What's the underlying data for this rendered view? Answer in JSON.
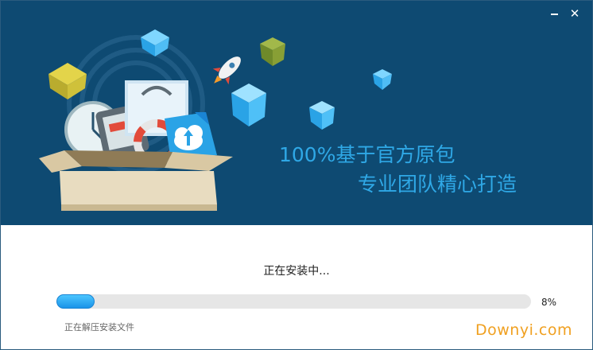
{
  "window": {
    "minimize_icon": "minimize-icon",
    "close_icon": "close-icon",
    "close_glyph": "✕"
  },
  "banner": {
    "slogan_line1": "100%基于官方原包",
    "slogan_line2": "专业团队精心打造",
    "accent_color": "#2fa8e6",
    "background_color": "#0e4a72"
  },
  "install": {
    "status_text": "正在安装中...",
    "progress_value": 0.08,
    "progress_label": "8%",
    "detail_text": "正在解压安装文件"
  },
  "watermark": {
    "text": "Downyi.com"
  }
}
